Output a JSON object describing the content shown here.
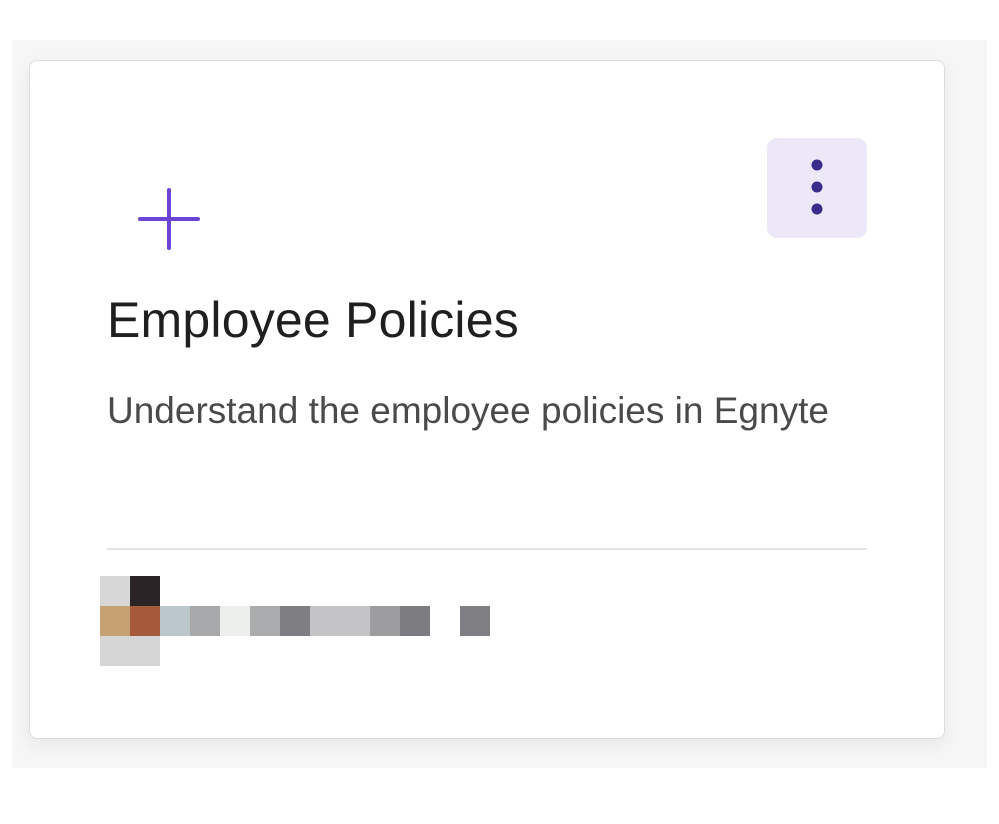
{
  "card": {
    "title": "Employee Policies",
    "description": "Understand the employee policies in Egnyte",
    "add_icon": "plus-icon",
    "menu_icon": "more-vertical-icon"
  },
  "colors": {
    "accent": "#6b45d6",
    "menu_bg": "#ece8f7",
    "menu_dots": "#3a2c8a",
    "title": "#1f1f1f",
    "description": "#4a4a4a"
  }
}
